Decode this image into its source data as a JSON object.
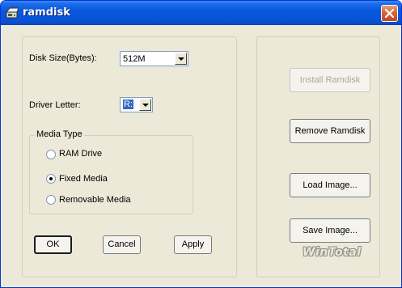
{
  "window": {
    "title": "ramdisk",
    "app_icon": "ramdisk-app-icon",
    "close_icon": "close-icon"
  },
  "form": {
    "disk_size": {
      "label": "Disk Size(Bytes):",
      "value": "512M"
    },
    "driver_letter": {
      "label": "Driver Letter:",
      "value": "R:"
    },
    "media_type": {
      "label": "Media Type",
      "options": [
        {
          "label": "RAM Drive",
          "selected": false
        },
        {
          "label": "Fixed Media",
          "selected": true
        },
        {
          "label": "Removable Media",
          "selected": false
        }
      ]
    }
  },
  "buttons": {
    "ok": "OK",
    "cancel": "Cancel",
    "apply": "Apply",
    "install": "Install Ramdisk",
    "remove": "Remove Ramdisk",
    "load": "Load Image...",
    "save": "Save Image..."
  },
  "watermark": "WinTotal",
  "colors": {
    "title_bar": "#0A58DD",
    "close_button": "#D86A40",
    "face": "#ECE9D8",
    "selection": "#316AC5"
  }
}
